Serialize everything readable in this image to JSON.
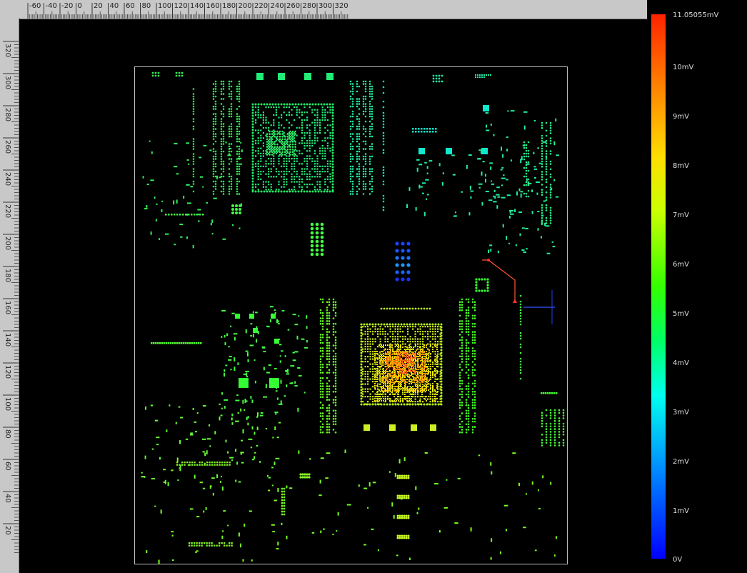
{
  "ruler_top": {
    "labels": [
      "-60",
      "-40",
      "-20",
      "0",
      "20",
      "40",
      "60",
      "80",
      "100",
      "120",
      "140",
      "160",
      "180",
      "200",
      "220",
      "240",
      "260",
      "280",
      "300",
      "320"
    ]
  },
  "ruler_left": {
    "labels": [
      "320",
      "300",
      "280",
      "260",
      "240",
      "220",
      "200",
      "180",
      "160",
      "140",
      "120",
      "100",
      "80",
      "60",
      "40",
      "20"
    ]
  },
  "legend": {
    "max_label": "11.05055mV",
    "labels": [
      "10mV",
      "9mV",
      "8mV",
      "7mV",
      "6mV",
      "5mV",
      "4mV",
      "3mV",
      "2mV",
      "1mV",
      "0V"
    ]
  },
  "colors": {
    "board_border": "#bfbfbf",
    "high_voltage": "#ff3300",
    "low_voltage": "#0000ff",
    "mid_green": "#33ff33",
    "trace_red": "#ff5533",
    "trace_blue": "#3355ff"
  }
}
